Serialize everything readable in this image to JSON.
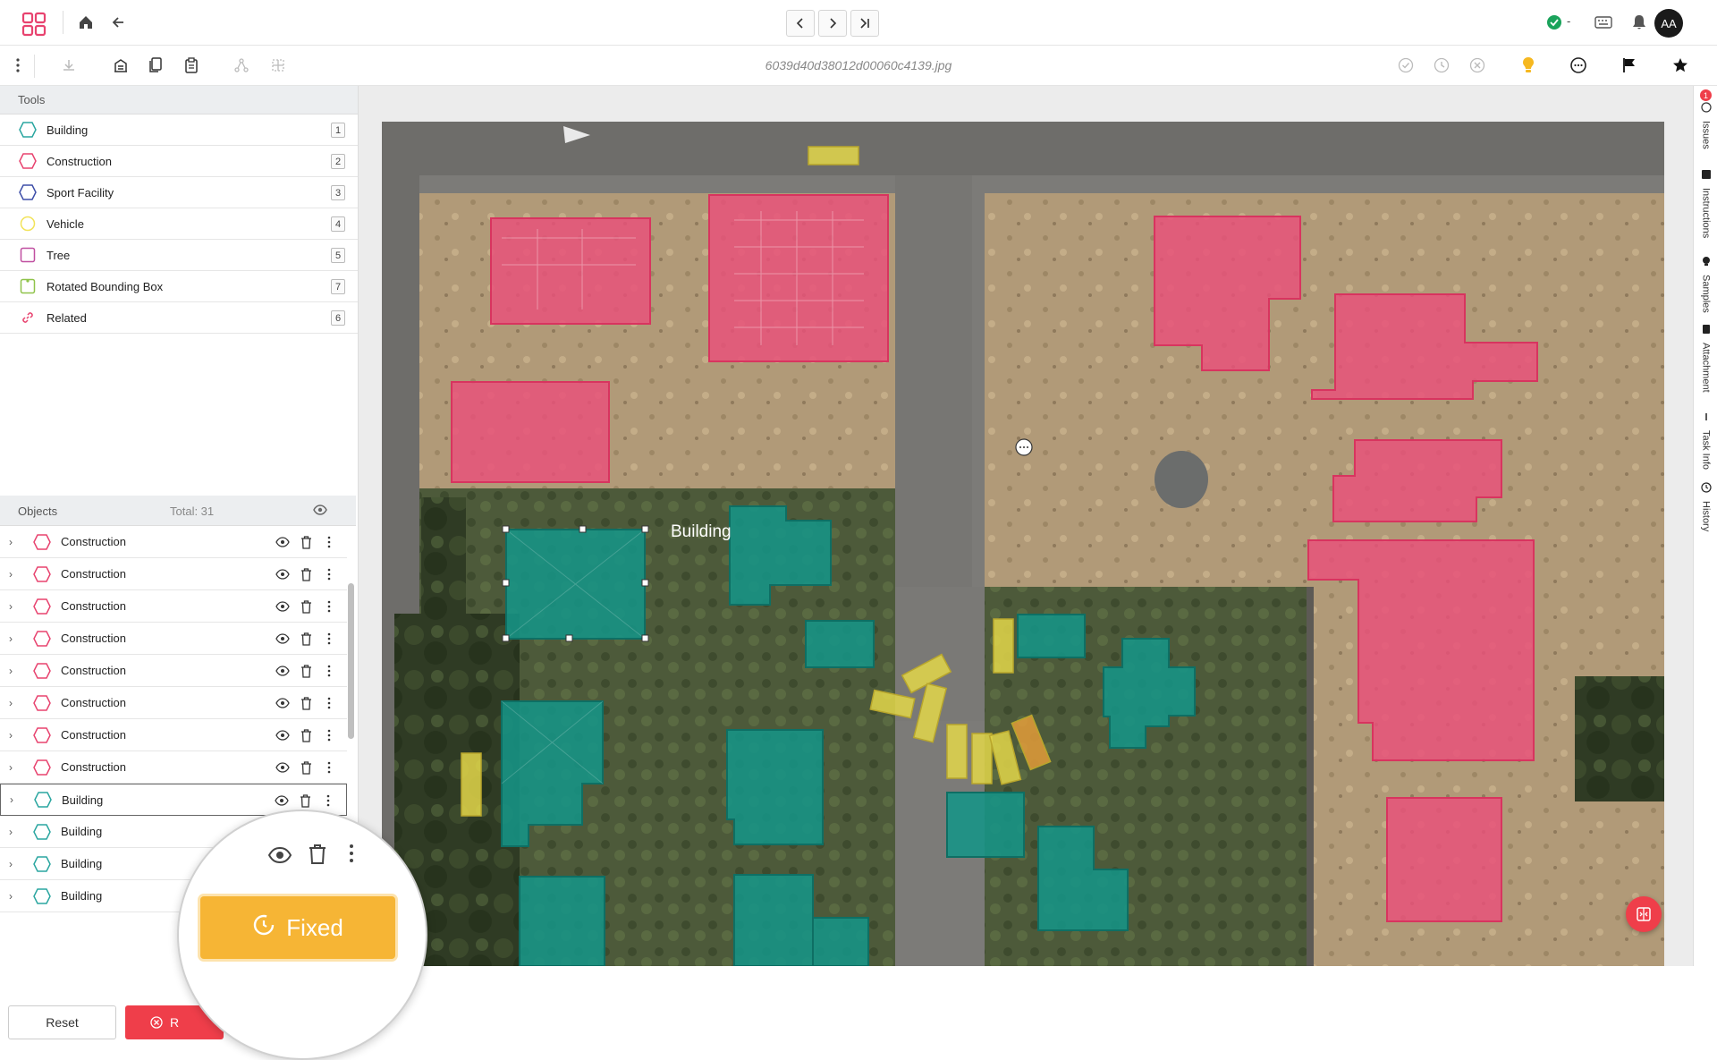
{
  "header": {
    "logo_icon": "grid-logo-icon",
    "status_indicator": "-",
    "avatar_initials": "AA",
    "status_color": "#1aa35b"
  },
  "toolbar": {
    "filename": "6039d40d38012d00060c4139.jpg"
  },
  "tools": {
    "title": "Tools",
    "items": [
      {
        "label": "Building",
        "key": "1",
        "shape": "hexagon",
        "color": "#2aa6a0"
      },
      {
        "label": "Construction",
        "key": "2",
        "shape": "hexagon",
        "color": "#e8436f"
      },
      {
        "label": "Sport Facility",
        "key": "3",
        "shape": "hexagon",
        "color": "#3e4fa8"
      },
      {
        "label": "Vehicle",
        "key": "4",
        "shape": "circle",
        "color": "#f2e35a"
      },
      {
        "label": "Tree",
        "key": "5",
        "shape": "square",
        "color": "#c04fa0"
      },
      {
        "label": "Rotated Bounding Box",
        "key": "7",
        "shape": "rotated-box",
        "color": "#8fc34a"
      },
      {
        "label": "Related",
        "key": "6",
        "shape": "link",
        "color": "#e8436f"
      }
    ]
  },
  "objects": {
    "title": "Objects",
    "total": "Total: 31",
    "items": [
      {
        "label": "Construction",
        "color": "#e8436f"
      },
      {
        "label": "Construction",
        "color": "#e8436f"
      },
      {
        "label": "Construction",
        "color": "#e8436f"
      },
      {
        "label": "Construction",
        "color": "#e8436f"
      },
      {
        "label": "Construction",
        "color": "#e8436f"
      },
      {
        "label": "Construction",
        "color": "#e8436f"
      },
      {
        "label": "Construction",
        "color": "#e8436f"
      },
      {
        "label": "Construction",
        "color": "#e8436f"
      },
      {
        "label": "Building",
        "color": "#2aa6a0",
        "selected": true
      },
      {
        "label": "Building",
        "color": "#2aa6a0"
      },
      {
        "label": "Building",
        "color": "#2aa6a0"
      },
      {
        "label": "Building",
        "color": "#2aa6a0"
      }
    ]
  },
  "buttons": {
    "reset": "Reset",
    "reject": "R",
    "fixed": "Fixed"
  },
  "canvas": {
    "annotation_label": "Building",
    "colors": {
      "building": "#169486",
      "construction": "#ea4f7a",
      "vehicle": "#e3d74a"
    }
  },
  "rail": {
    "issues_count": "1",
    "items": [
      "Issues",
      "Instructions",
      "Samples",
      "Attachment",
      "Task Info",
      "History"
    ]
  }
}
